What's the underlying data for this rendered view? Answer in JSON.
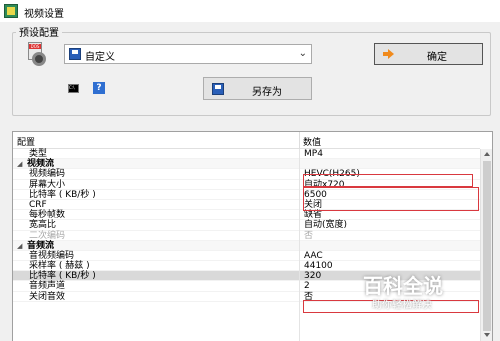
{
  "window": {
    "title": "视频设置"
  },
  "preset_group": {
    "label": "预设配置",
    "selected_preset": "自定义",
    "ok_label": "确定",
    "save_as_label": "另存为",
    "help_glyph": "?"
  },
  "grid": {
    "headers": {
      "name": "配置",
      "value": "数值"
    },
    "rows": [
      {
        "name": "类型",
        "value": "MP4"
      },
      {
        "name": "视频流",
        "value": "",
        "category": true
      },
      {
        "name": "视频编码",
        "value": "HEVC(H265)"
      },
      {
        "name": "屏幕大小",
        "value": "自动x720"
      },
      {
        "name": "比特率 ( KB/秒 )",
        "value": "6500"
      },
      {
        "name": "CRF",
        "value": "关闭"
      },
      {
        "name": "每秒帧数",
        "value": "缺省"
      },
      {
        "name": "宽高比",
        "value": "自动(宽度)"
      },
      {
        "name": "二次编码",
        "value": "否",
        "disabled": true
      },
      {
        "name": "音频流",
        "value": "",
        "category": true
      },
      {
        "name": "音视频编码",
        "value": "AAC"
      },
      {
        "name": "采样率 ( 赫兹 )",
        "value": "44100"
      },
      {
        "name": "比特率 ( KB/秒 )",
        "value": "320",
        "selected": true
      },
      {
        "name": "音频声道",
        "value": "2"
      },
      {
        "name": "关闭音效",
        "value": "否"
      }
    ]
  },
  "watermark": {
    "title": "百科全说",
    "subtitle": "助你轻松解决"
  },
  "colors": {
    "highlight": "#d9393f",
    "accent": "#f08a1c"
  }
}
